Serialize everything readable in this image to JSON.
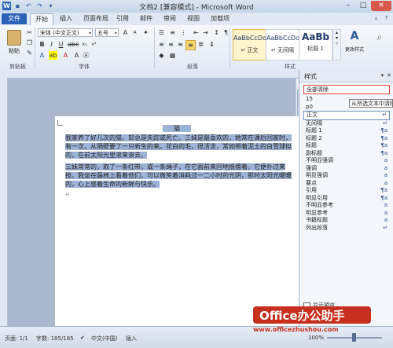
{
  "window": {
    "title": "文档2 [兼容模式] - Microsoft Word",
    "quick_access": [
      "save-icon",
      "undo-icon",
      "redo-icon",
      "customize-icon"
    ]
  },
  "tabs": [
    "文件",
    "开始",
    "插入",
    "页面布局",
    "引用",
    "邮件",
    "审阅",
    "视图",
    "加载项"
  ],
  "ribbon": {
    "clipboard": {
      "paste_label": "粘贴",
      "group_label": "剪贴板"
    },
    "font": {
      "font_name": "宋体 (中文正文)",
      "font_size": "五号",
      "group_label": "字体"
    },
    "paragraph": {
      "group_label": "段落"
    },
    "styles": {
      "gallery": [
        {
          "sample": "AaBbCcDd",
          "label": "↵ 正文"
        },
        {
          "sample": "AaBbCcDd",
          "label": "↵ 无间隔"
        },
        {
          "sample": "AaBb",
          "label": "标题 1"
        }
      ],
      "change_styles_label": "更改样式",
      "group_label": "样式"
    }
  },
  "document": {
    "title": "猫",
    "paragraphs": [
      "我家养了好几次的猫，却总是失踪或死亡。三妹是最喜欢的，她常在课后回家时，有一次，从隔壁要了一只新生的来。花白的毛，很活泼，常如带着泥土的白雪球似的，在前太阳光里滚来滚去。",
      "三妹常常的，取了一条红带，或一条绳子，在它面前来回地摇摆着，它便扑过来抢。我坐在藤椅上看着他们，可以微笑着消耗过一二小时的光阴，那时太阳光暖暖的，心上感着生命的新鲜与快乐。"
    ]
  },
  "styles_pane": {
    "title": "样式",
    "items": [
      {
        "label": "全部清除",
        "mark": ""
      },
      {
        "label": "15",
        "mark": ""
      },
      {
        "label": "p0",
        "mark": ""
      },
      {
        "label": "正文",
        "mark": "↵"
      },
      {
        "label": "无间隔",
        "mark": "↵"
      },
      {
        "label": "标题 1",
        "mark": "¶a"
      },
      {
        "label": "标题 2",
        "mark": "¶a"
      },
      {
        "label": "标题",
        "mark": "¶a"
      },
      {
        "label": "副标题",
        "mark": "¶a"
      },
      {
        "label": "不明显强调",
        "mark": "a"
      },
      {
        "label": "强调",
        "mark": "a"
      },
      {
        "label": "明显强调",
        "mark": "a"
      },
      {
        "label": "要点",
        "mark": "a"
      },
      {
        "label": "引用",
        "mark": "¶a"
      },
      {
        "label": "明显引用",
        "mark": "¶a"
      },
      {
        "label": "不明显参考",
        "mark": "a"
      },
      {
        "label": "明显参考",
        "mark": "a"
      },
      {
        "label": "书籍标题",
        "mark": "a"
      },
      {
        "label": "列出段落",
        "mark": "↵"
      }
    ],
    "tooltip": "从所选文本中清除格式和样式",
    "show_preview_label": "显示预览"
  },
  "status_bar": {
    "page": "页面: 1/1",
    "words": "字数: 185/185",
    "language": "中文(中国)",
    "mode": "插入",
    "zoom": "100%",
    "zoom_level": 0.45
  },
  "watermark": {
    "logo_text": "Office办公助手",
    "url": "www.officezhushou.com"
  },
  "colors": {
    "file_tab": "#2a62b9",
    "selection": "#9cb3d8",
    "watermark": "#c72f1e"
  }
}
